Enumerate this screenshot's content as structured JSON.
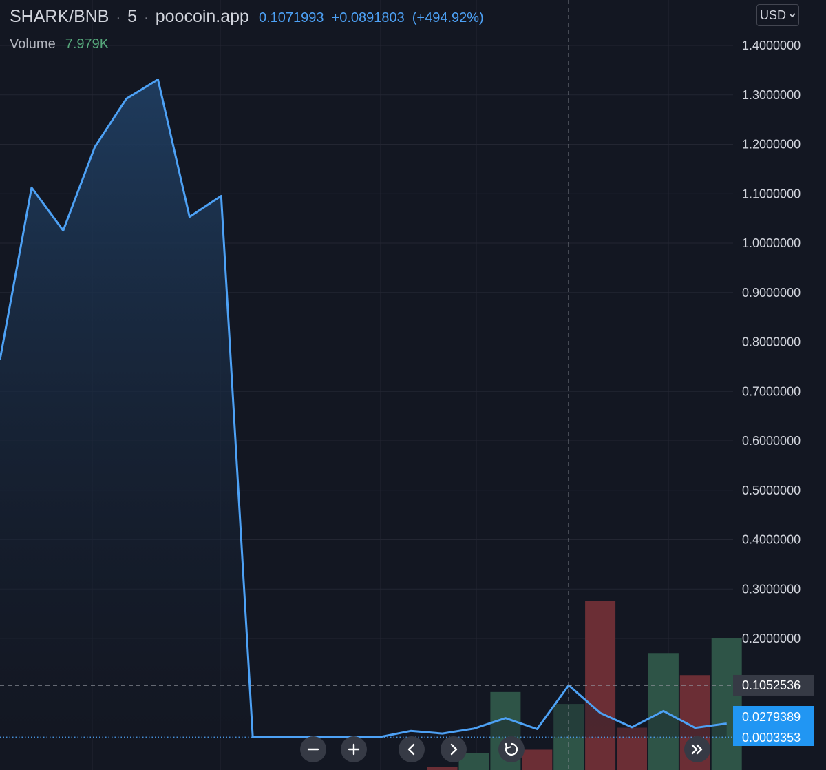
{
  "header": {
    "symbol": "SHARK/BNB",
    "separator": "·",
    "interval": "5",
    "source": "poocoin.app",
    "last_price": "0.1071993",
    "change": "+0.0891803",
    "change_pct": "(+494.92%)",
    "volume_label": "Volume",
    "volume_value": "7.979K"
  },
  "currency_button": {
    "label": "USD",
    "icon": "chevron-down-icon"
  },
  "controls": [
    {
      "name": "zoom-out-button",
      "icon": "minus-icon"
    },
    {
      "name": "zoom-in-button",
      "icon": "plus-icon"
    },
    {
      "name": "scroll-left-button",
      "icon": "chevron-left-icon"
    },
    {
      "name": "scroll-right-button",
      "icon": "chevron-right-icon"
    },
    {
      "name": "reset-chart-button",
      "icon": "reset-icon"
    },
    {
      "name": "scroll-to-realtime-button",
      "icon": "double-chevron-right-icon"
    }
  ],
  "colors": {
    "background": "#131722",
    "line": "#4da1f5",
    "grid": "#232632",
    "volume_up": "#2e5447",
    "volume_down": "#6b2e35",
    "tag_blue": "#2196f3",
    "text": "#d1d4dc"
  },
  "chart_data": {
    "type": "area",
    "series": [
      {
        "name": "SHARK/BNB",
        "values": [
          0.7645,
          1.1123,
          1.0255,
          1.1944,
          1.2922,
          1.3312,
          1.0533,
          1.0955,
          0.0003,
          0.0001,
          0.0003,
          0.0002,
          0.0003,
          0.0128,
          0.0075,
          0.0177,
          0.0388,
          0.0167,
          0.1052536,
          0.0492,
          0.0204,
          0.0531,
          0.0192,
          0.0279389
        ]
      }
    ],
    "volume": [
      {
        "index": 14,
        "direction": "down",
        "height": 0.02
      },
      {
        "index": 15,
        "direction": "up",
        "height": 0.1
      },
      {
        "index": 16,
        "direction": "up",
        "height": 0.46
      },
      {
        "index": 17,
        "direction": "down",
        "height": 0.12
      },
      {
        "index": 18,
        "direction": "up",
        "height": 0.39
      },
      {
        "index": 19,
        "direction": "down",
        "height": 1.0
      },
      {
        "index": 20,
        "direction": "down",
        "height": 0.25
      },
      {
        "index": 21,
        "direction": "up",
        "height": 0.69
      },
      {
        "index": 22,
        "direction": "down",
        "height": 0.56
      },
      {
        "index": 23,
        "direction": "up",
        "height": 0.78
      }
    ],
    "y_ticks": [
      "1.4000000",
      "1.3000000",
      "1.2000000",
      "1.1000000",
      "1.0000000",
      "0.9000000",
      "0.8000000",
      "0.7000000",
      "0.6000000",
      "0.5000000",
      "0.4000000",
      "0.3000000",
      "0.2000000"
    ],
    "ylim": [
      0,
      1.42
    ],
    "grid": true,
    "crosshair": {
      "index": 18,
      "price": "0.1052536"
    },
    "price_tags": {
      "last": "0.0279389",
      "low": "0.0003353"
    }
  }
}
